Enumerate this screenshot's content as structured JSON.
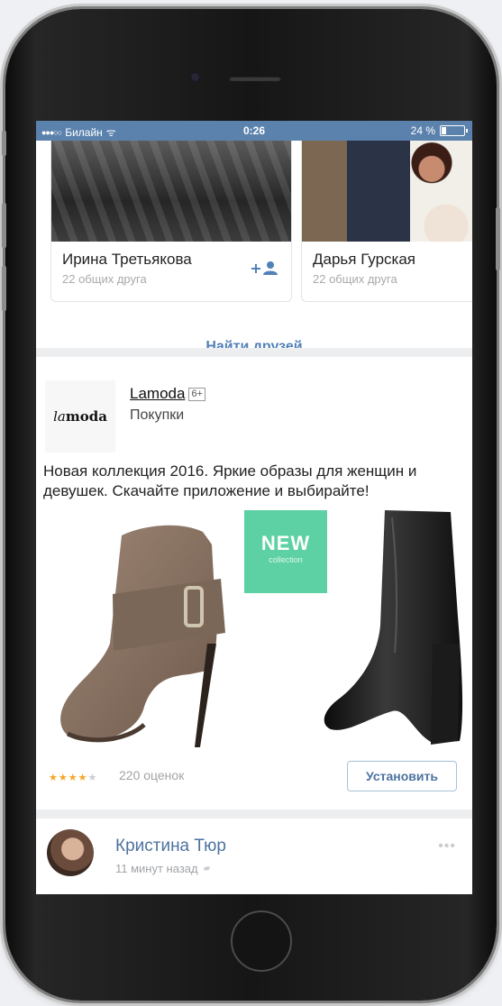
{
  "status_bar": {
    "signal": "●●●○○",
    "carrier": "Билайн",
    "wifi": "ᯤ",
    "time": "0:26",
    "battery": "24 %",
    "battery_level": 0.24
  },
  "friends": {
    "cards": [
      {
        "name": "Ирина Третьякова",
        "mutual": "22 общих друга",
        "add_icon": "add-friend-icon"
      },
      {
        "name": "Дарья Гурская",
        "mutual": "22 общих друга"
      }
    ],
    "find_link": "Найти друзей"
  },
  "ad": {
    "logo_bold": "la",
    "logo_rest": "moda",
    "title": "Lamoda",
    "age": "6+",
    "category": "Покупки",
    "text": "Новая коллекция 2016. Яркие образы для женщин и девушек. Скачайте приложение и выбирайте!",
    "badge_title": "NEW",
    "badge_sub": "collection",
    "badge_color": "#5dd1a3",
    "rating": 4,
    "rating_max": 5,
    "ratings_count": "220 оценок",
    "install_label": "Установить"
  },
  "post": {
    "author": "Кристина Тюр",
    "time": "11 минут назад",
    "more_icon": "more-icon"
  },
  "colors": {
    "accent": "#5181b8",
    "status_bar": "#5b82ad"
  }
}
